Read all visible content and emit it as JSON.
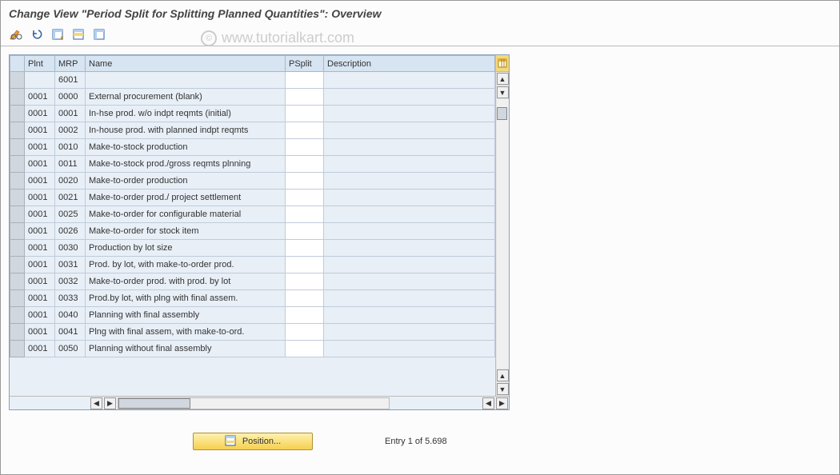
{
  "title": "Change View \"Period Split for Splitting Planned Quantities\": Overview",
  "watermark": "www.tutorialkart.com",
  "toolbar": {
    "icons": [
      "pencil-with-glasses",
      "undo",
      "select-all",
      "deselect-all",
      "select-block"
    ]
  },
  "columns": {
    "plnt": "Plnt",
    "mrp": "MRP",
    "name": "Name",
    "psplit": "PSplit",
    "desc": "Description"
  },
  "rows": [
    {
      "plnt": "",
      "mrp": "6001",
      "name": ""
    },
    {
      "plnt": "0001",
      "mrp": "0000",
      "name": "External procurement             (blank)"
    },
    {
      "plnt": "0001",
      "mrp": "0001",
      "name": "In-hse prod. w/o indpt reqmts (initial)"
    },
    {
      "plnt": "0001",
      "mrp": "0002",
      "name": "In-house prod. with planned indpt reqmts"
    },
    {
      "plnt": "0001",
      "mrp": "0010",
      "name": "Make-to-stock production"
    },
    {
      "plnt": "0001",
      "mrp": "0011",
      "name": "Make-to-stock prod./gross reqmts plnning"
    },
    {
      "plnt": "0001",
      "mrp": "0020",
      "name": "Make-to-order production"
    },
    {
      "plnt": "0001",
      "mrp": "0021",
      "name": "Make-to-order prod./ project settlement"
    },
    {
      "plnt": "0001",
      "mrp": "0025",
      "name": "Make-to-order for configurable material"
    },
    {
      "plnt": "0001",
      "mrp": "0026",
      "name": "Make-to-order for stock item"
    },
    {
      "plnt": "0001",
      "mrp": "0030",
      "name": "Production by lot size"
    },
    {
      "plnt": "0001",
      "mrp": "0031",
      "name": "Prod. by lot, with make-to-order prod."
    },
    {
      "plnt": "0001",
      "mrp": "0032",
      "name": "Make-to-order prod. with prod. by lot"
    },
    {
      "plnt": "0001",
      "mrp": "0033",
      "name": "Prod.by lot, with plng with final assem."
    },
    {
      "plnt": "0001",
      "mrp": "0040",
      "name": "Planning with final assembly"
    },
    {
      "plnt": "0001",
      "mrp": "0041",
      "name": "Plng with final assem, with make-to-ord."
    },
    {
      "plnt": "0001",
      "mrp": "0050",
      "name": "Planning without final assembly"
    }
  ],
  "footer": {
    "position_label": "Position...",
    "entry_text": "Entry 1 of 5.698"
  },
  "colors": {
    "header_bg": "#d7e4f2",
    "cell_bg": "#e8eff7",
    "accent_yellow": "#f5d050"
  }
}
